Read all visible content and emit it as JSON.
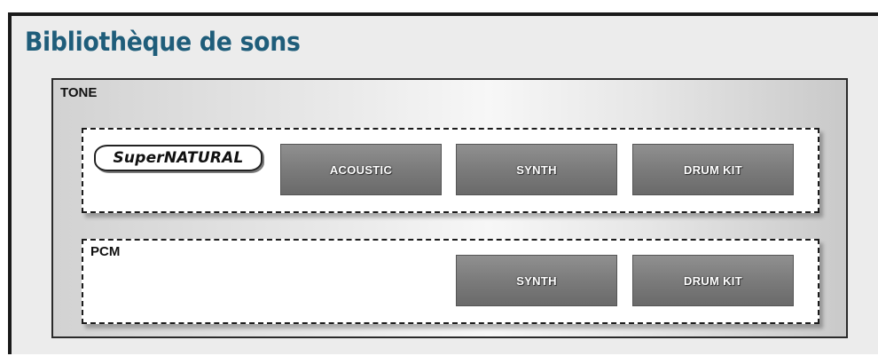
{
  "title": "Bibliothèque de sons",
  "tone": {
    "label": "TONE",
    "supernatural": {
      "logo_text": "SuperNATURAL",
      "buttons": [
        "ACOUSTIC",
        "SYNTH",
        "DRUM KIT"
      ]
    },
    "pcm": {
      "label": "PCM",
      "buttons": [
        "SYNTH",
        "DRUM KIT"
      ]
    }
  },
  "colors": {
    "title": "#1f5d7a",
    "button": "#7b7b7b",
    "button_text": "#ffffff",
    "group_border": "#1b1b1b"
  }
}
